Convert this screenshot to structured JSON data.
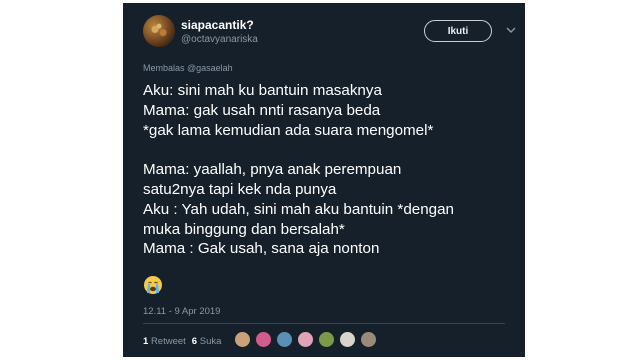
{
  "user": {
    "display_name": "siapacantik?",
    "handle": "@octavyanariska",
    "avatar_icon": "profile-photo"
  },
  "follow_button": {
    "label": "Ikuti"
  },
  "reply_to": "Membalas @gasaelah",
  "tweet_lines": [
    "Aku: sini mah ku bantuin masaknya",
    "Mama: gak usah nnti rasanya beda",
    "*gak lama kemudian ada suara mengomel*",
    "",
    "Mama: yaallah, pnya anak perempuan",
    "satu2nya tapi kek nda punya",
    "Aku : Yah udah, sini mah aku bantuin *dengan",
    "muka binggung dan bersalah*",
    "Mama : Gak usah, sana aja nonton"
  ],
  "emoji": "crying-face-emoji",
  "timestamp": "12.11 - 9 Apr 2019",
  "stats": {
    "retweet_count": "1",
    "retweet_label": "Retweet",
    "like_count": "6",
    "like_label": "Suka"
  },
  "liker_avatars": [
    {
      "color": "#c9a27a"
    },
    {
      "color": "#d15b8a"
    },
    {
      "color": "#5b8fb5"
    },
    {
      "color": "#e0a3b8"
    },
    {
      "color": "#7a9a4a"
    },
    {
      "color": "#d8d4cc"
    },
    {
      "color": "#9b8a7a"
    }
  ],
  "colors": {
    "background": "#15202b",
    "text": "#ffffff",
    "secondary_text": "#8899a6",
    "divider": "#38444d"
  }
}
